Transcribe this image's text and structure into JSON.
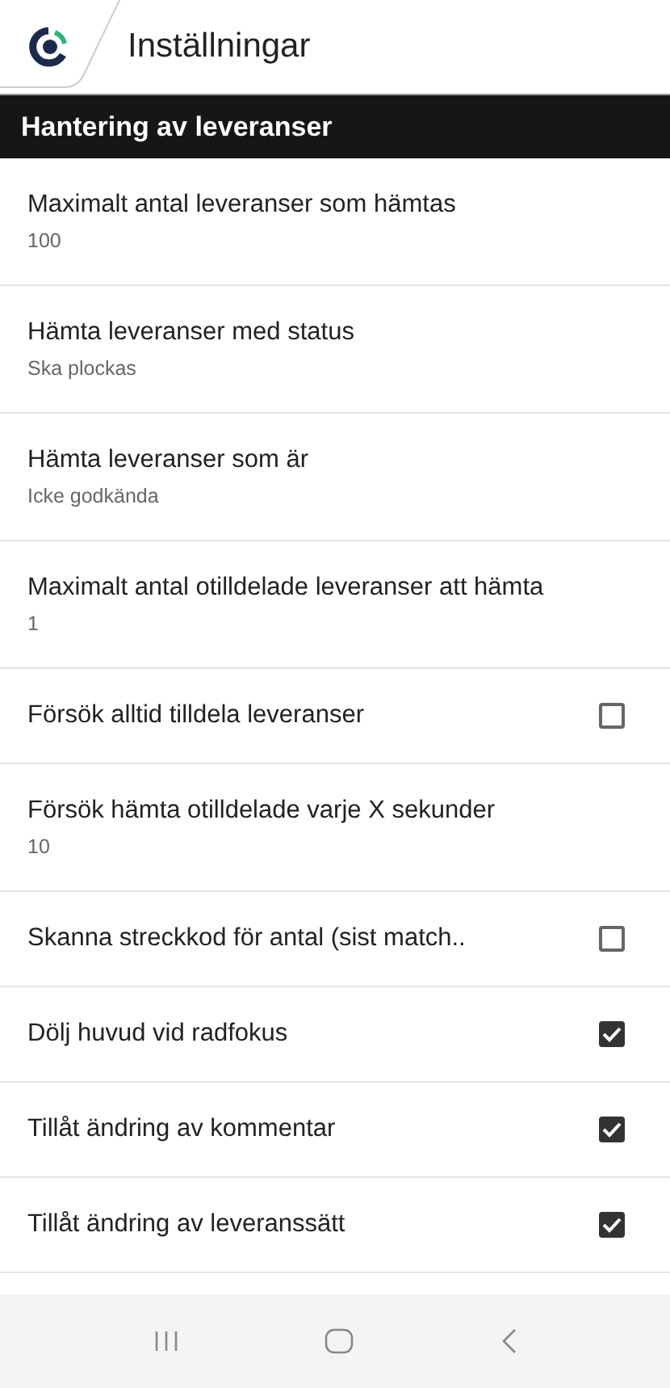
{
  "header": {
    "title": "Inställningar"
  },
  "section": {
    "title": "Hantering av leveranser"
  },
  "settings": [
    {
      "kind": "value",
      "label": "Maximalt antal leveranser som hämtas",
      "value": "100"
    },
    {
      "kind": "value",
      "label": "Hämta leveranser med status",
      "value": "Ska plockas"
    },
    {
      "kind": "value",
      "label": "Hämta leveranser som är",
      "value": "Icke godkända"
    },
    {
      "kind": "value",
      "label": "Maximalt antal otilldelade leveranser att hämta",
      "value": "1"
    },
    {
      "kind": "checkbox",
      "label": "Försök alltid tilldela leveranser",
      "checked": false
    },
    {
      "kind": "value",
      "label": "Försök hämta otilldelade varje X sekunder",
      "value": "10"
    },
    {
      "kind": "checkbox",
      "label": "Skanna streckkod för antal (sist match..",
      "checked": false
    },
    {
      "kind": "checkbox",
      "label": "Dölj huvud vid radfokus",
      "checked": true
    },
    {
      "kind": "checkbox",
      "label": "Tillåt ändring av kommentar",
      "checked": true
    },
    {
      "kind": "checkbox",
      "label": "Tillåt ändring av leveranssätt",
      "checked": true
    }
  ]
}
